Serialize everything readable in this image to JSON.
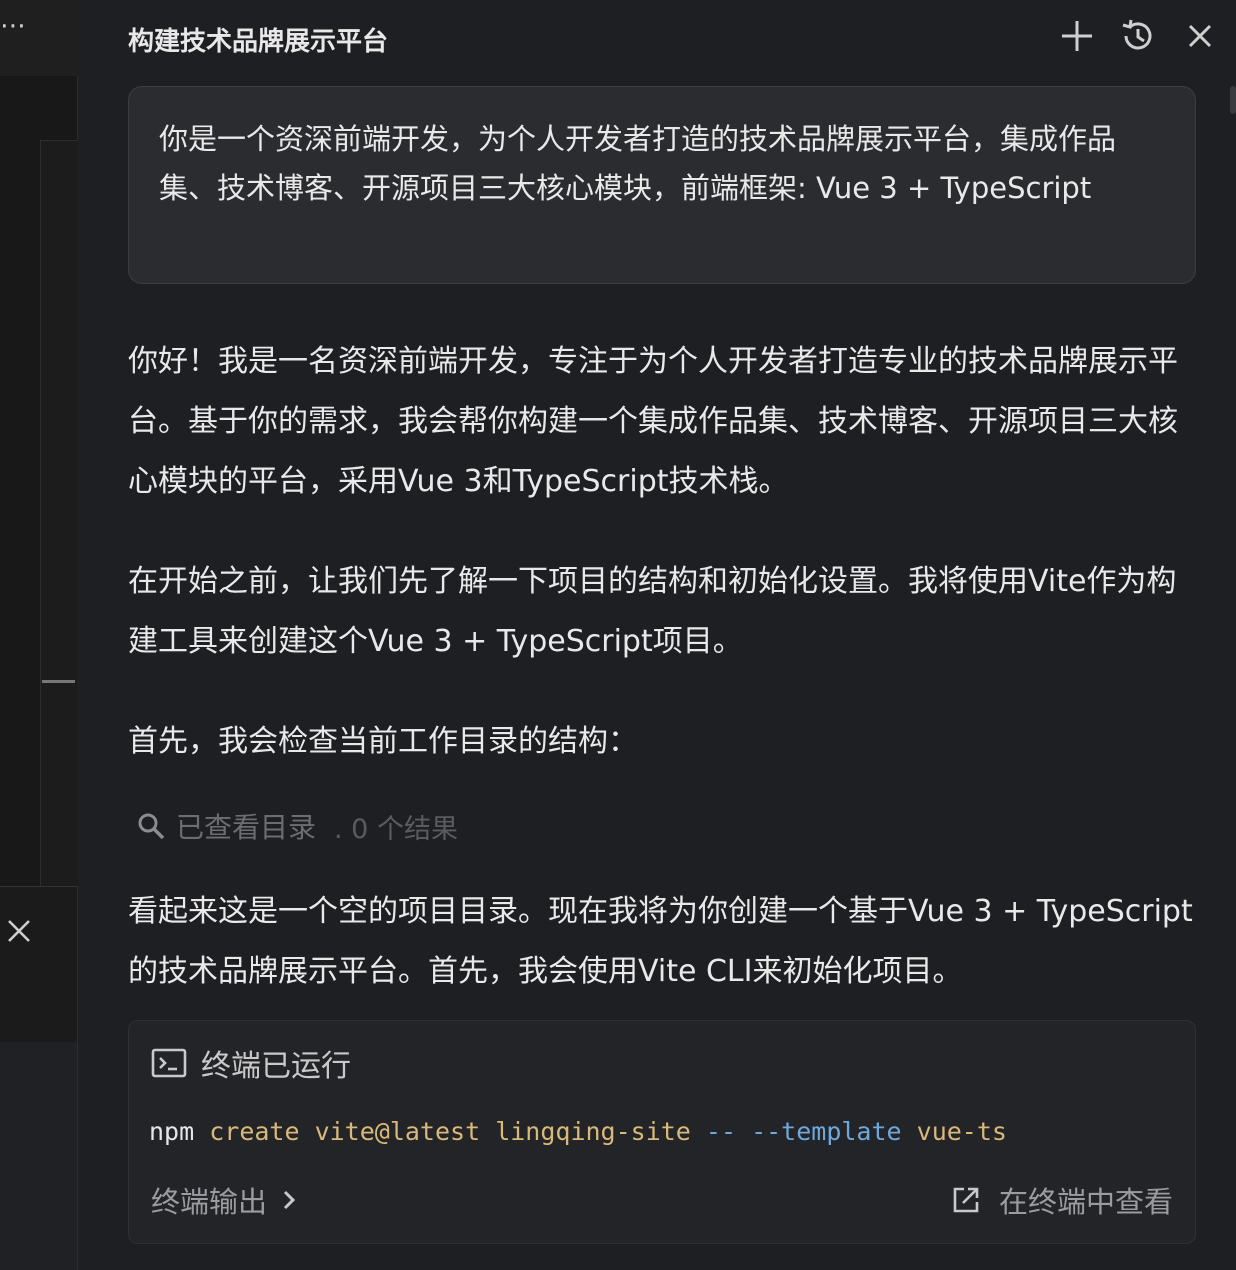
{
  "left_panel": {
    "more_icon": "ellipsis-icon",
    "close_icon": "close-icon"
  },
  "header": {
    "title": "构建技术品牌展示平台",
    "add_icon": "plus-icon",
    "history_icon": "history-icon",
    "close_icon": "close-icon"
  },
  "conversation": {
    "user_message": "你是一个资深前端开发，为个人开发者打造的技术品牌展示平台，集成作品集、技术博客、开源项目三大核心模块，前端框架: Vue 3 + TypeScript",
    "assistant": {
      "para1": "你好！我是一名资深前端开发，专注于为个人开发者打造专业的技术品牌展示平台。基于你的需求，我会帮你构建一个集成作品集、技术博客、开源项目三大核心模块的平台，采用Vue 3和TypeScript技术栈。",
      "para2": "在开始之前，让我们先了解一下项目的结构和初始化设置。我将使用Vite作为构建工具来创建这个Vue 3 + TypeScript项目。",
      "para3": "首先，我会检查当前工作目录的结构：",
      "tool": {
        "icon": "search-icon",
        "label": "已查看目录",
        "result": ". 0 个结果"
      },
      "para4": "看起来这是一个空的项目目录。现在我将为你创建一个基于Vue 3 + TypeScript的技术品牌展示平台。首先，我会使用Vite CLI来初始化项目。"
    },
    "terminal": {
      "icon": "terminal-icon",
      "title": "终端已运行",
      "command": {
        "bin": "npm",
        "args": "create vite@latest lingqing-site",
        "flags": "-- --template",
        "tail": "vue-ts"
      },
      "output_label": "终端输出",
      "open_label": "在终端中查看",
      "open_icon": "external-link-icon"
    }
  },
  "colors": {
    "background": "#1e1f22",
    "bubble": "#2b2c30",
    "terminal_card": "#232428",
    "cmd_arg": "#d9b97a",
    "cmd_flag": "#6fa8dc"
  }
}
